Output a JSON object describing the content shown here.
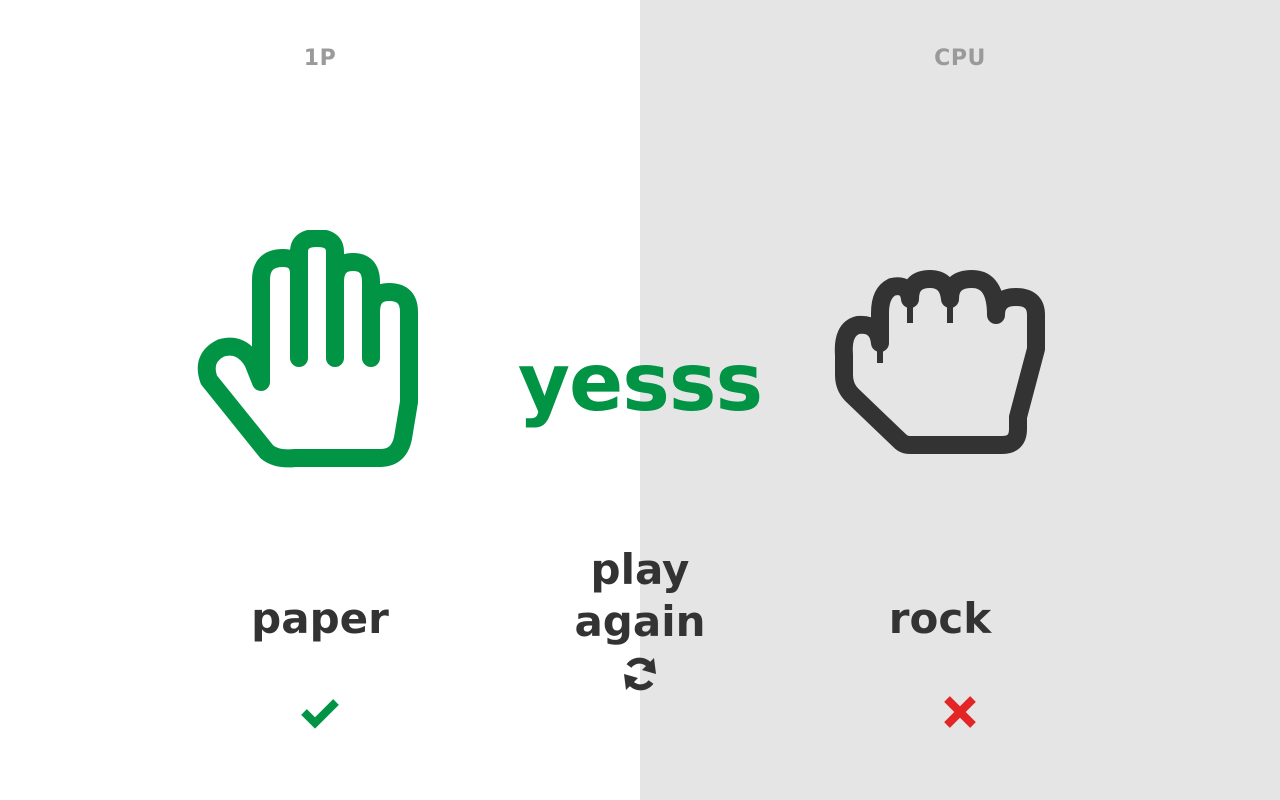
{
  "players": {
    "left": {
      "label": "1P",
      "choice": "paper",
      "hand_icon": "paper-hand-icon",
      "result_icon": "checkmark-icon"
    },
    "right": {
      "label": "CPU",
      "choice": "rock",
      "hand_icon": "rock-fist-icon",
      "result_icon": "cross-icon"
    }
  },
  "outcome": "yesss",
  "play_again": {
    "line1": "play",
    "line2": "again",
    "icon": "refresh-icon"
  },
  "colors": {
    "win": "#009444",
    "lose": "#e32526",
    "text": "#333333",
    "label": "#9a9a9a",
    "right_panel_bg": "#e5e5e5"
  }
}
